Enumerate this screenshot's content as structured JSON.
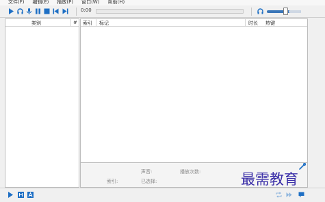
{
  "menu": [
    "文件(F)",
    "编辑(E)",
    "播放(P)",
    "窗口(W)",
    "帮助(H)"
  ],
  "toolbar": {
    "time": "0:00",
    "volume_level": 0.55
  },
  "left_pane": {
    "col_category": "类别",
    "col_count": "#"
  },
  "right_pane": {
    "col_index": "索引",
    "col_mark": "标记",
    "col_duration": "时长",
    "col_hotkey": "热键"
  },
  "info": {
    "sound": "声音:",
    "play_count": "播放次数:",
    "index": "索引:",
    "selected": "已选择:"
  },
  "watermark": "最需教育",
  "colors": {
    "accent": "#1e6fc4",
    "volume": "#3a76b8",
    "watermark": "#3b2fa8"
  }
}
